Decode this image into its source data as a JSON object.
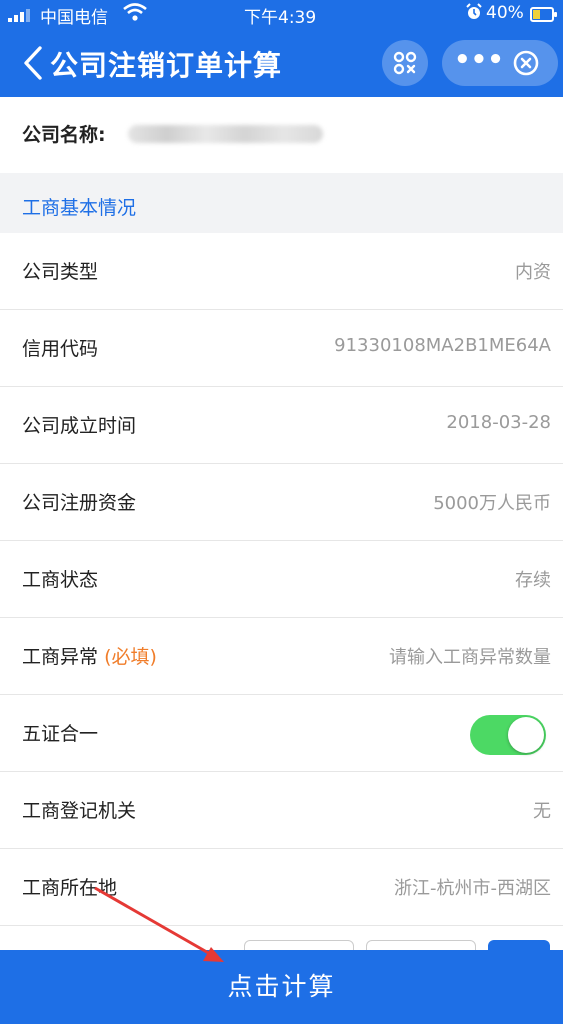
{
  "status_bar": {
    "carrier": "中国电信",
    "time": "下午4:39",
    "battery_percent": "40%",
    "battery_level": 0.4,
    "battery_color": "#f0d23a"
  },
  "nav": {
    "title": "公司注销订单计算",
    "back_icon": "chevron-left-icon",
    "scan_icon": "scan-icon",
    "more_icon": "more-dots-icon",
    "close_icon": "close-circle-icon",
    "more_label": "•••",
    "color": "#1e6fe6"
  },
  "company": {
    "label": "公司名称:"
  },
  "section": {
    "title": "工商基本情况"
  },
  "fields": {
    "company_type": {
      "label": "公司类型",
      "value": "内资"
    },
    "credit_code": {
      "label": "信用代码",
      "value": "91330108MA2B1ME64A"
    },
    "established": {
      "label": "公司成立时间",
      "value": "2018-03-28"
    },
    "registered_capital": {
      "label": "公司注册资金",
      "value": "5000万人民币"
    },
    "business_status": {
      "label": "工商状态",
      "value": "存续"
    },
    "business_abnormal": {
      "label": "工商异常",
      "required": "(必填)",
      "placeholder": "请输入工商异常数量"
    },
    "five_in_one": {
      "label": "五证合一",
      "enabled": true,
      "on_color": "#4cd964"
    },
    "registration_authority": {
      "label": "工商登记机关",
      "value": "无"
    },
    "location": {
      "label": "工商所在地",
      "value": "浙江-杭州市-西湖区"
    }
  },
  "action": {
    "calculate_label": "点击计算"
  }
}
